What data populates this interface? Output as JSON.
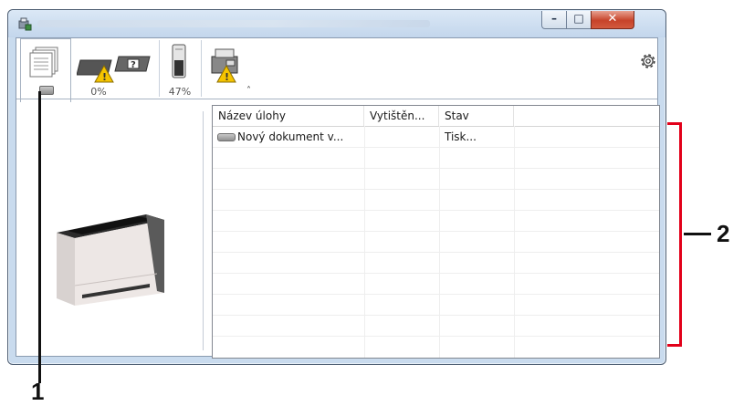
{
  "window": {
    "title": ""
  },
  "toolbar": {
    "tabs": [
      {
        "id": "jobs",
        "icon": "document-stack-icon",
        "label": ""
      },
      {
        "id": "toner-warning",
        "icon": "toner-warning-icon",
        "label": "0%"
      },
      {
        "id": "paper",
        "icon": "paper-level-icon",
        "label": "47%"
      },
      {
        "id": "device",
        "icon": "device-warning-icon",
        "label": ""
      }
    ],
    "collapse_glyph": "˄",
    "settings_icon": "gear-icon"
  },
  "job_list": {
    "columns": [
      "Název úlohy",
      "Vytištěn...",
      "Stav"
    ],
    "rows": [
      {
        "name": "Nový dokument v...",
        "printed": "",
        "status": "Tisk..."
      }
    ],
    "empty_rows": 8
  },
  "annotations": {
    "callout_1": "1",
    "callout_2": "2",
    "accent": "#e2001a"
  }
}
